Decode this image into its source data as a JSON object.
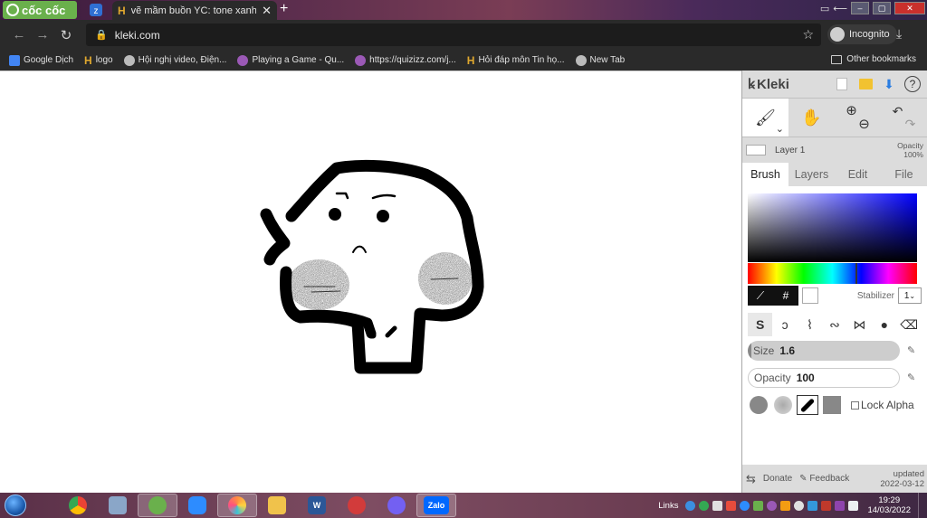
{
  "browser": {
    "brand": "cốc cốc",
    "active_tab_title": "vẽ mầm buồn YC: tone xanh",
    "url": "kleki.com",
    "incognito_label": "Incognito",
    "bookmarks": [
      {
        "label": "Google Dịch",
        "icon": "google-translate-icon",
        "color": "#4285f4"
      },
      {
        "label": "logo",
        "icon": "h-icon",
        "color": "#e0a82e"
      },
      {
        "label": "Hội nghị video, Điện...",
        "icon": "globe-icon",
        "color": "#bbbbbb"
      },
      {
        "label": "Playing a Game - Qu...",
        "icon": "quizizz-icon",
        "color": "#9b59b6"
      },
      {
        "label": "https://quizizz.com/j...",
        "icon": "quizizz-icon",
        "color": "#9b59b6"
      },
      {
        "label": "Hỏi đáp môn Tin họ...",
        "icon": "h-icon",
        "color": "#e0a82e"
      },
      {
        "label": "New Tab",
        "icon": "globe-icon",
        "color": "#bbbbbb"
      }
    ],
    "other_bookmarks": "Other bookmarks"
  },
  "kleki": {
    "logo": "Kleki",
    "layer_name": "Layer 1",
    "layer_opacity_label": "Opacity",
    "layer_opacity_value": "100%",
    "tabs": [
      "Brush",
      "Layers",
      "Edit",
      "File"
    ],
    "active_tab": "Brush",
    "color_picker_hash": "#",
    "stabilizer_label": "Stabilizer",
    "stabilizer_value": "1",
    "size_label": "Size",
    "size_value": "1.6",
    "opacity_label": "Opacity",
    "opacity_value": "100",
    "lock_alpha_label": "Lock Alpha",
    "footer_donate": "Donate",
    "footer_feedback": "Feedback",
    "footer_updated_label": "updated",
    "footer_updated_date": "2022-03-12",
    "colors": {
      "primary": "#000000",
      "secondary": "#ffffff",
      "hue": "#0000ff"
    }
  },
  "taskbar": {
    "apps": [
      {
        "name": "chrome-app",
        "icon": "chrome-icon",
        "color": "#34a853",
        "active": false
      },
      {
        "name": "paint-app",
        "icon": "paint-icon",
        "color": "#8aa6c8",
        "active": false
      },
      {
        "name": "coccoc-app",
        "icon": "coccoc-icon",
        "color": "#6ab04c",
        "active": true
      },
      {
        "name": "zoom-app",
        "icon": "zoom-icon",
        "color": "#2d8cff",
        "active": false
      },
      {
        "name": "paint3d-app",
        "icon": "paint3d-icon",
        "color": "#ff8c42",
        "active": true
      },
      {
        "name": "explorer-app",
        "icon": "folder-icon",
        "color": "#f0c24b",
        "active": false
      },
      {
        "name": "word-app",
        "icon": "word-icon",
        "color": "#2b5797",
        "active": false,
        "letter": "W"
      },
      {
        "name": "antivirus-app",
        "icon": "shield-icon",
        "color": "#d23b3b",
        "active": false
      },
      {
        "name": "viber-app",
        "icon": "viber-icon",
        "color": "#7360f2",
        "active": false
      },
      {
        "name": "zalo-app",
        "icon": "zalo-icon",
        "color": "#0068ff",
        "active": true,
        "letter": "Zalo"
      }
    ],
    "links_label": "Links",
    "time": "19:29",
    "date": "14/03/2022"
  }
}
